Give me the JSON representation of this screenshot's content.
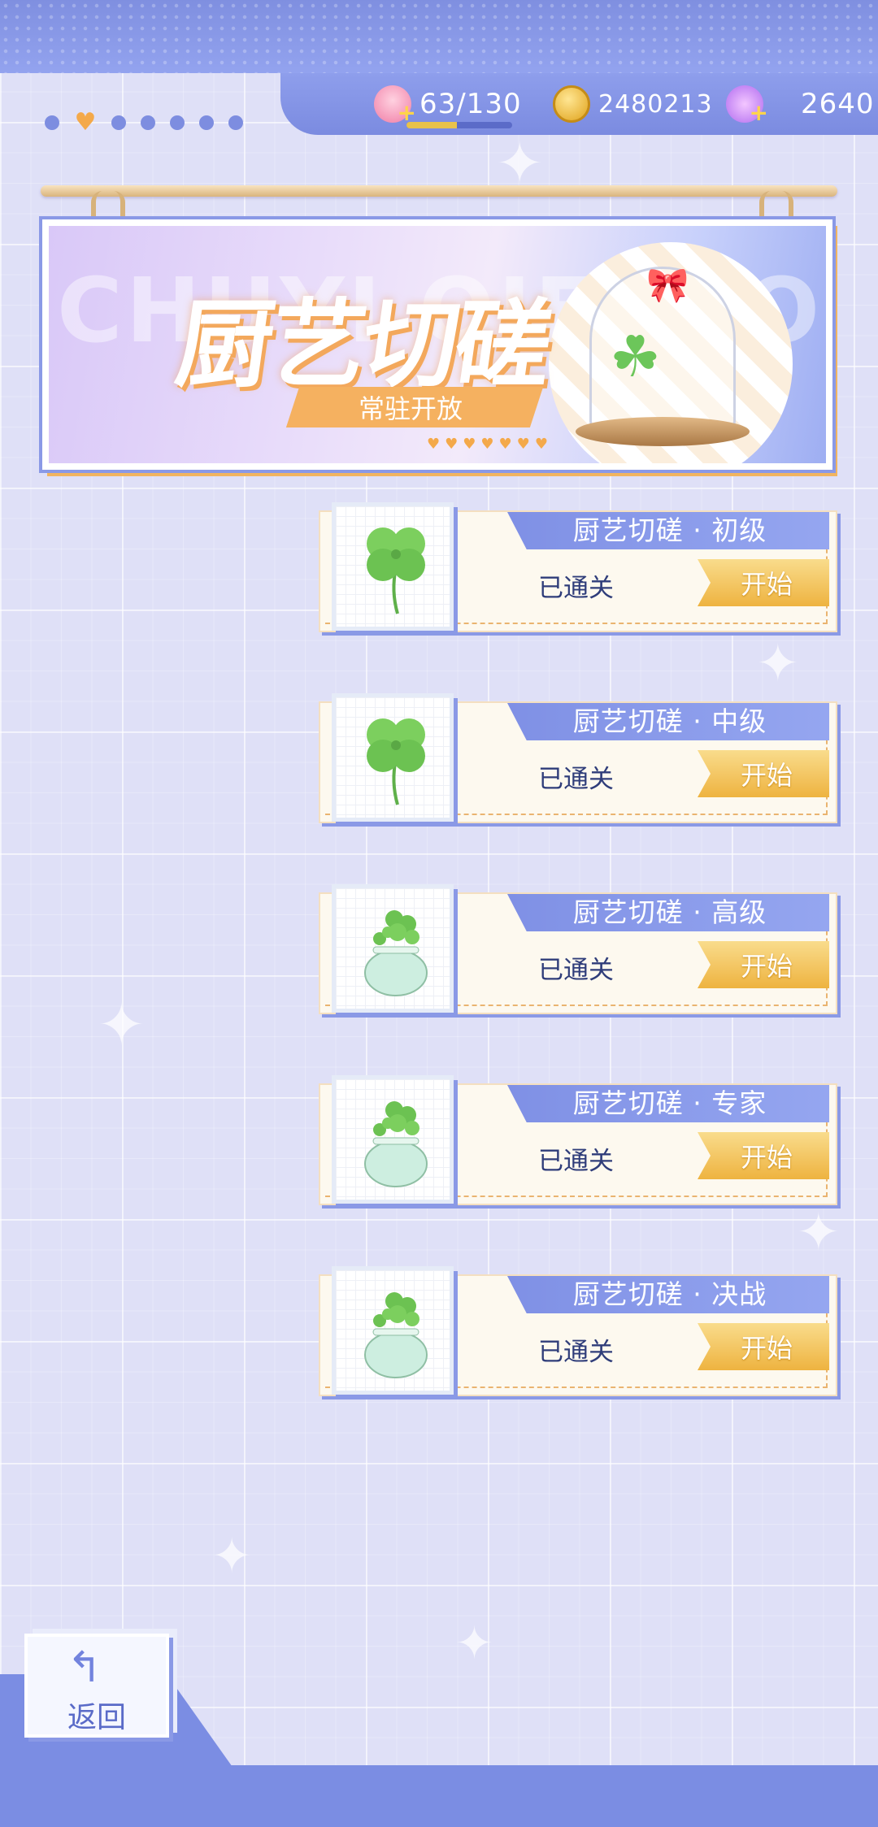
{
  "resources": {
    "stamina": "63/130",
    "stamina_fraction": 0.48,
    "coins": "2480213",
    "diamonds": "2640"
  },
  "pager": {
    "count": 7,
    "active_index": 1
  },
  "banner": {
    "title": "厨艺切磋",
    "watermark": "CHUYI QIECUO",
    "subtitle": "常驻开放",
    "hearts": "♥♥♥♥♥♥♥"
  },
  "levels": [
    {
      "title": "厨艺切磋 · 初级",
      "status": "已通关",
      "start_label": "开始",
      "icon": "four-leaf-clover-icon"
    },
    {
      "title": "厨艺切磋 · 中级",
      "status": "已通关",
      "start_label": "开始",
      "icon": "four-leaf-clover-icon"
    },
    {
      "title": "厨艺切磋 · 高级",
      "status": "已通关",
      "start_label": "开始",
      "icon": "clover-pot-icon"
    },
    {
      "title": "厨艺切磋 · 专家",
      "status": "已通关",
      "start_label": "开始",
      "icon": "clover-pot-icon"
    },
    {
      "title": "厨艺切磋 · 决战",
      "status": "已通关",
      "start_label": "开始",
      "icon": "clover-pot-icon"
    }
  ],
  "back": {
    "label": "返回"
  },
  "colors": {
    "accent": "#7f90e5",
    "button": "#eeb340",
    "text_dark": "#2f3d7a"
  }
}
